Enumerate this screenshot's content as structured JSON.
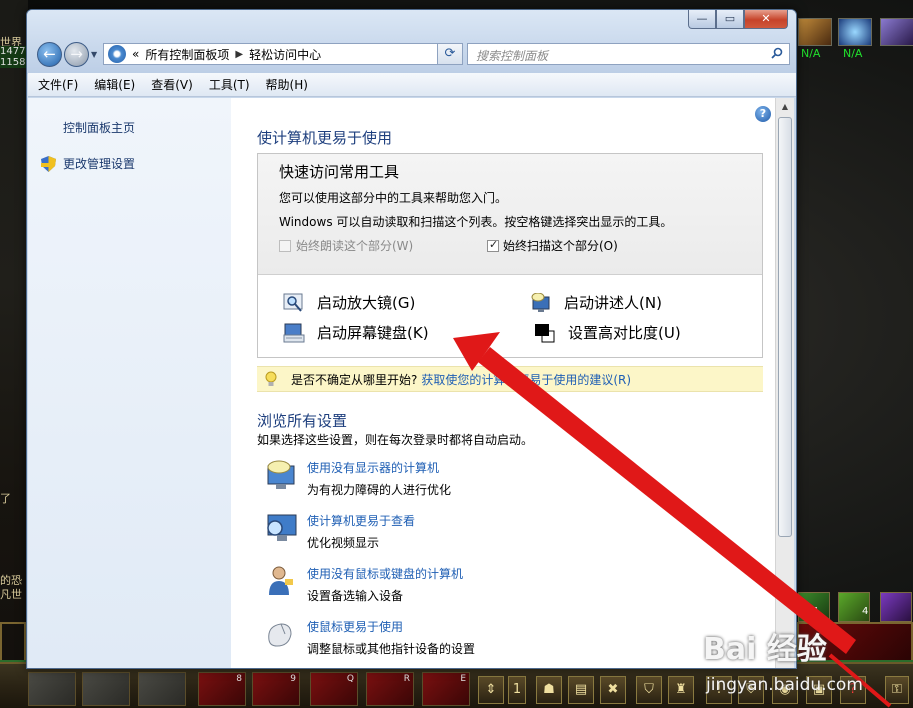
{
  "window": {
    "caption_min": "—",
    "caption_max": "▭",
    "caption_close": "✕"
  },
  "nav": {
    "breadcrumb_prefix": "«",
    "breadcrumb": [
      "所有控制面板项",
      "轻松访问中心"
    ],
    "search_placeholder": "搜索控制面板"
  },
  "menu": [
    "文件(F)",
    "编辑(E)",
    "查看(V)",
    "工具(T)",
    "帮助(H)"
  ],
  "sidebar": {
    "home": "控制面板主页",
    "admin": "更改管理设置"
  },
  "main": {
    "heading": "使计算机更易于使用",
    "help": "?",
    "quick": {
      "title": "快速访问常用工具",
      "line1": "您可以使用这部分中的工具来帮助您入门。",
      "line2": "Windows 可以自动读取和扫描这个列表。按空格键选择突出显示的工具。",
      "read_label": "始终朗读这个部分(W)",
      "read_checked": false,
      "scan_label": "始终扫描这个部分(O)",
      "scan_checked": true,
      "tools": [
        {
          "label": "启动放大镜(G)",
          "icon": "magnifier-icon"
        },
        {
          "label": "启动讲述人(N)",
          "icon": "narrator-icon"
        },
        {
          "label": "启动屏幕键盘(K)",
          "icon": "keyboard-icon"
        },
        {
          "label": "设置高对比度(U)",
          "icon": "contrast-icon"
        }
      ]
    },
    "tip": {
      "question": "是否不确定从哪里开始?",
      "link": "获取使您的计算机更易于使用的建议(R)"
    },
    "browse": {
      "heading": "浏览所有设置",
      "note": "如果选择这些设置，则在每次登录时都将自动启动。",
      "items": [
        {
          "link": "使用没有显示器的计算机",
          "desc": "为有视力障碍的人进行优化",
          "icon": "monitor-speech-icon"
        },
        {
          "link": "使计算机更易于查看",
          "desc": "优化视频显示",
          "icon": "monitor-icon"
        },
        {
          "link": "使用没有鼠标或键盘的计算机",
          "desc": "设置备选输入设备",
          "icon": "person-icon"
        },
        {
          "link": "使鼠标更易于使用",
          "desc": "调整鼠标或其他指针设备的设置",
          "icon": "mouse-icon"
        }
      ]
    }
  },
  "game": {
    "left_top_text": "世界",
    "left_numbers": "1477\n1158",
    "left_mid1": "了",
    "left_mid2": "的恐",
    "left_mid3": "凡世",
    "na1": "N/A",
    "na2": "N/A",
    "slot_nums": [
      "8",
      "9",
      "Q",
      "R",
      "E"
    ],
    "badge1": "4",
    "badge2": "4",
    "num_box": "1"
  },
  "watermark": {
    "brand": "Bai  经验",
    "sub": "jingyan.baidu.com"
  },
  "colors": {
    "link": "#1f5fb4",
    "heading": "#1e3f7e",
    "arrow": "#e01818",
    "game_na": "#21e02d"
  }
}
